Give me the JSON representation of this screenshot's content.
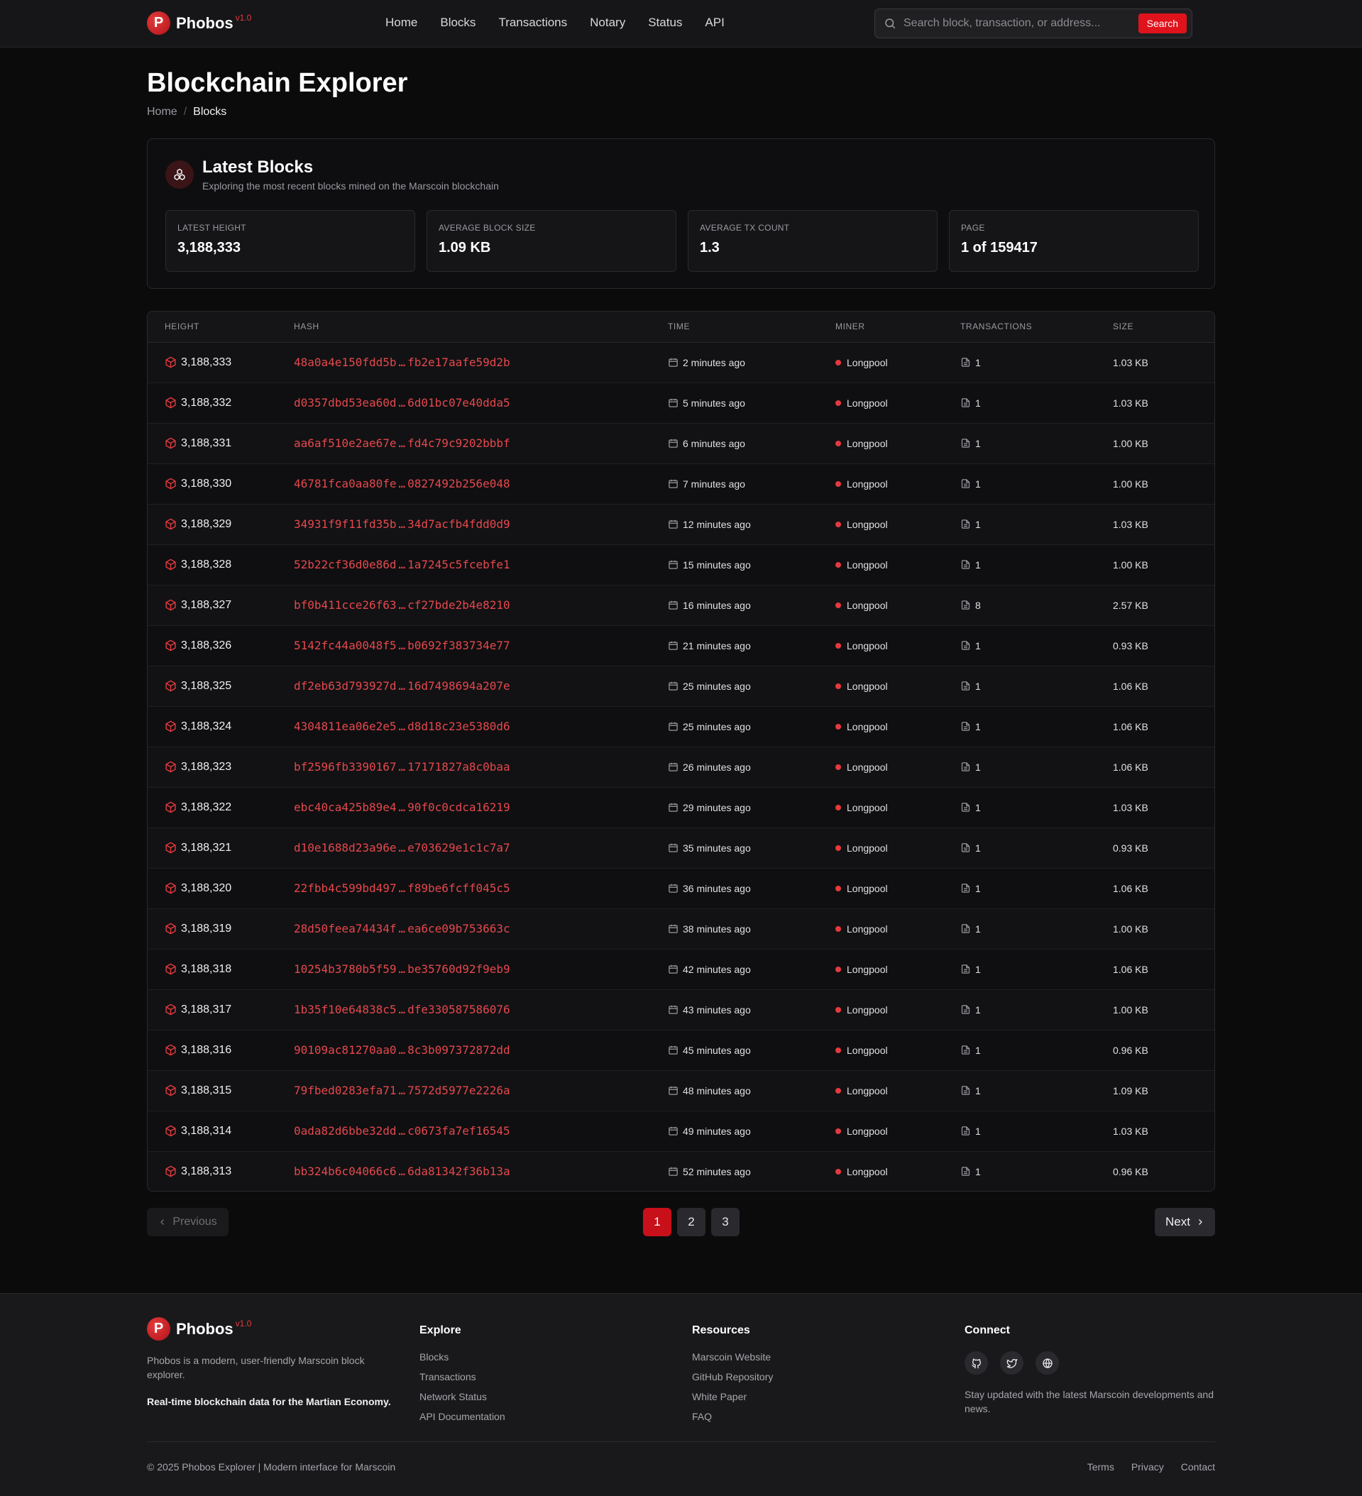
{
  "header": {
    "logo_letter": "P",
    "brand": "Phobos",
    "version": "v1.0",
    "nav": [
      "Home",
      "Blocks",
      "Transactions",
      "Notary",
      "Status",
      "API"
    ],
    "search_placeholder": "Search block, transaction, or address...",
    "search_button": "Search"
  },
  "page": {
    "title": "Blockchain Explorer",
    "breadcrumb": [
      "Home",
      "Blocks"
    ]
  },
  "summary": {
    "title": "Latest Blocks",
    "subtitle": "Exploring the most recent blocks mined on the Marscoin blockchain",
    "stats": [
      {
        "label": "LATEST HEIGHT",
        "value": "3,188,333"
      },
      {
        "label": "AVERAGE BLOCK SIZE",
        "value": "1.09 KB"
      },
      {
        "label": "AVERAGE TX COUNT",
        "value": "1.3"
      },
      {
        "label": "PAGE",
        "value": "1 of 159417"
      }
    ]
  },
  "table": {
    "columns": [
      "HEIGHT",
      "HASH",
      "TIME",
      "MINER",
      "TRANSACTIONS",
      "SIZE"
    ],
    "rows": [
      {
        "height": "3,188,333",
        "hash_start": "48a0a4e150fdd5b",
        "hash_end": "fb2e17aafe59d2b",
        "time": "2 minutes ago",
        "miner": "Longpool",
        "tx": "1",
        "size": "1.03 KB"
      },
      {
        "height": "3,188,332",
        "hash_start": "d0357dbd53ea60d",
        "hash_end": "6d01bc07e40dda5",
        "time": "5 minutes ago",
        "miner": "Longpool",
        "tx": "1",
        "size": "1.03 KB"
      },
      {
        "height": "3,188,331",
        "hash_start": "aa6af510e2ae67e",
        "hash_end": "fd4c79c9202bbbf",
        "time": "6 minutes ago",
        "miner": "Longpool",
        "tx": "1",
        "size": "1.00 KB"
      },
      {
        "height": "3,188,330",
        "hash_start": "46781fca0aa80fe",
        "hash_end": "0827492b256e048",
        "time": "7 minutes ago",
        "miner": "Longpool",
        "tx": "1",
        "size": "1.00 KB"
      },
      {
        "height": "3,188,329",
        "hash_start": "34931f9f11fd35b",
        "hash_end": "34d7acfb4fdd0d9",
        "time": "12 minutes ago",
        "miner": "Longpool",
        "tx": "1",
        "size": "1.03 KB"
      },
      {
        "height": "3,188,328",
        "hash_start": "52b22cf36d0e86d",
        "hash_end": "1a7245c5fcebfe1",
        "time": "15 minutes ago",
        "miner": "Longpool",
        "tx": "1",
        "size": "1.00 KB"
      },
      {
        "height": "3,188,327",
        "hash_start": "bf0b411cce26f63",
        "hash_end": "cf27bde2b4e8210",
        "time": "16 minutes ago",
        "miner": "Longpool",
        "tx": "8",
        "size": "2.57 KB"
      },
      {
        "height": "3,188,326",
        "hash_start": "5142fc44a0048f5",
        "hash_end": "b0692f383734e77",
        "time": "21 minutes ago",
        "miner": "Longpool",
        "tx": "1",
        "size": "0.93 KB"
      },
      {
        "height": "3,188,325",
        "hash_start": "df2eb63d793927d",
        "hash_end": "16d7498694a207e",
        "time": "25 minutes ago",
        "miner": "Longpool",
        "tx": "1",
        "size": "1.06 KB"
      },
      {
        "height": "3,188,324",
        "hash_start": "4304811ea06e2e5",
        "hash_end": "d8d18c23e5380d6",
        "time": "25 minutes ago",
        "miner": "Longpool",
        "tx": "1",
        "size": "1.06 KB"
      },
      {
        "height": "3,188,323",
        "hash_start": "bf2596fb3390167",
        "hash_end": "17171827a8c0baa",
        "time": "26 minutes ago",
        "miner": "Longpool",
        "tx": "1",
        "size": "1.06 KB"
      },
      {
        "height": "3,188,322",
        "hash_start": "ebc40ca425b89e4",
        "hash_end": "90f0c0cdca16219",
        "time": "29 minutes ago",
        "miner": "Longpool",
        "tx": "1",
        "size": "1.03 KB"
      },
      {
        "height": "3,188,321",
        "hash_start": "d10e1688d23a96e",
        "hash_end": "e703629e1c1c7a7",
        "time": "35 minutes ago",
        "miner": "Longpool",
        "tx": "1",
        "size": "0.93 KB"
      },
      {
        "height": "3,188,320",
        "hash_start": "22fbb4c599bd497",
        "hash_end": "f89be6fcff045c5",
        "time": "36 minutes ago",
        "miner": "Longpool",
        "tx": "1",
        "size": "1.06 KB"
      },
      {
        "height": "3,188,319",
        "hash_start": "28d50feea74434f",
        "hash_end": "ea6ce09b753663c",
        "time": "38 minutes ago",
        "miner": "Longpool",
        "tx": "1",
        "size": "1.00 KB"
      },
      {
        "height": "3,188,318",
        "hash_start": "10254b3780b5f59",
        "hash_end": "be35760d92f9eb9",
        "time": "42 minutes ago",
        "miner": "Longpool",
        "tx": "1",
        "size": "1.06 KB"
      },
      {
        "height": "3,188,317",
        "hash_start": "1b35f10e64838c5",
        "hash_end": "dfe330587586076",
        "time": "43 minutes ago",
        "miner": "Longpool",
        "tx": "1",
        "size": "1.00 KB"
      },
      {
        "height": "3,188,316",
        "hash_start": "90109ac81270aa0",
        "hash_end": "8c3b097372872dd",
        "time": "45 minutes ago",
        "miner": "Longpool",
        "tx": "1",
        "size": "0.96 KB"
      },
      {
        "height": "3,188,315",
        "hash_start": "79fbed0283efa71",
        "hash_end": "7572d5977e2226a",
        "time": "48 minutes ago",
        "miner": "Longpool",
        "tx": "1",
        "size": "1.09 KB"
      },
      {
        "height": "3,188,314",
        "hash_start": "0ada82d6bbe32dd",
        "hash_end": "c0673fa7ef16545",
        "time": "49 minutes ago",
        "miner": "Longpool",
        "tx": "1",
        "size": "1.03 KB"
      },
      {
        "height": "3,188,313",
        "hash_start": "bb324b6c04066c6",
        "hash_end": "6da81342f36b13a",
        "time": "52 minutes ago",
        "miner": "Longpool",
        "tx": "1",
        "size": "0.96 KB"
      }
    ]
  },
  "pagination": {
    "previous": "Previous",
    "next": "Next",
    "pages": [
      "1",
      "2",
      "3"
    ],
    "current": "1"
  },
  "footer": {
    "brand": "Phobos",
    "version": "v1.0",
    "description": "Phobos is a modern, user-friendly Marscoin block explorer.",
    "tagline": "Real-time blockchain data for the Martian Economy.",
    "explore_title": "Explore",
    "explore_links": [
      "Blocks",
      "Transactions",
      "Network Status",
      "API Documentation"
    ],
    "resources_title": "Resources",
    "resources_links": [
      "Marscoin Website",
      "GitHub Repository",
      "White Paper",
      "FAQ"
    ],
    "connect_title": "Connect",
    "social_icons": [
      "github-icon",
      "twitter-icon",
      "globe-icon"
    ],
    "newsletter": "Stay updated with the latest Marscoin developments and news.",
    "copyright": "© 2025 Phobos Explorer | Modern interface for Marscoin",
    "legal": [
      "Terms",
      "Privacy",
      "Contact"
    ]
  },
  "colors": {
    "accent": "#e0131c",
    "hash": "#e5484d",
    "background": "#0b0b0c"
  }
}
